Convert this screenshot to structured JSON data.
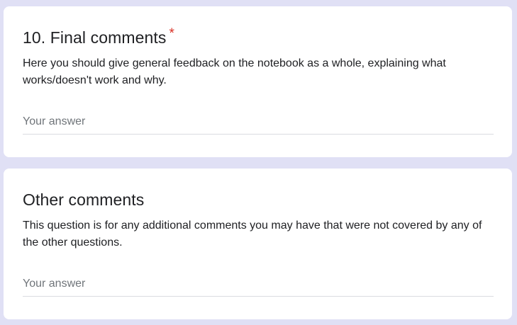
{
  "questions": [
    {
      "title": "10. Final comments",
      "required_mark": "*",
      "description": "Here you should give general feedback on the notebook as a whole, explaining what works/doesn't work and why.",
      "answer_placeholder": "Your answer",
      "answer_value": ""
    },
    {
      "title": "Other comments",
      "description": "This question is for any additional comments you may have that were not covered by any of the other questions.",
      "answer_placeholder": "Your answer",
      "answer_value": ""
    }
  ],
  "colors": {
    "page_background": "#e0e0f5",
    "card_background": "#ffffff",
    "required_star": "#d93025",
    "text_primary": "#202124",
    "placeholder": "#70757a",
    "underline": "#dadce0"
  }
}
